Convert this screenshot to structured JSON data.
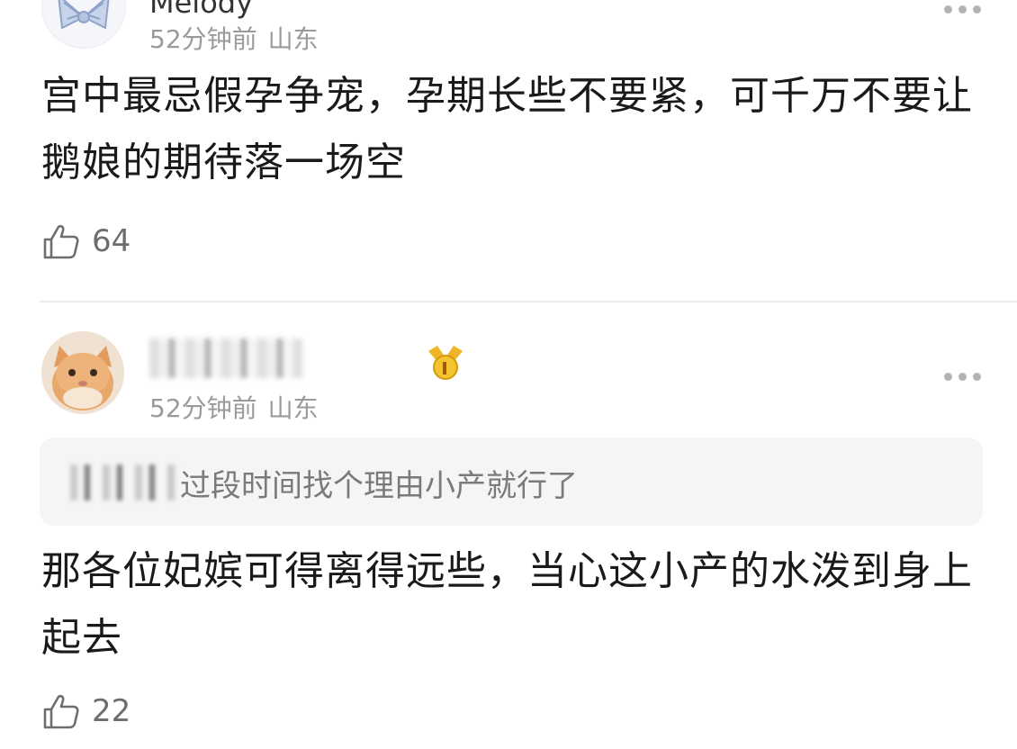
{
  "comments": [
    {
      "username": "Melody",
      "badge": "",
      "time": "52分钟前",
      "location": "山东",
      "text": "宫中最忌假孕争宠，孕期长些不要紧，可千万不要让鹅娘的期待落一场空",
      "likes": "64"
    },
    {
      "username": "",
      "badge": "",
      "time": "52分钟前",
      "location": "山东",
      "quote": {
        "author": "",
        "text": "过段时间找个理由小产就行了"
      },
      "text": "那各位妃嫔可得离得远些，当心这小产的水泼到身上起去",
      "likes": "22"
    }
  ],
  "icons": {
    "like": "thumbs-up-icon",
    "more": "more-icon",
    "medal": "medal-icon"
  },
  "colors": {
    "badge_bg": "#e5f7e6",
    "badge_text": "#33b14a",
    "meta_text": "#9a9a9a",
    "quote_bg": "#f5f5f7"
  }
}
